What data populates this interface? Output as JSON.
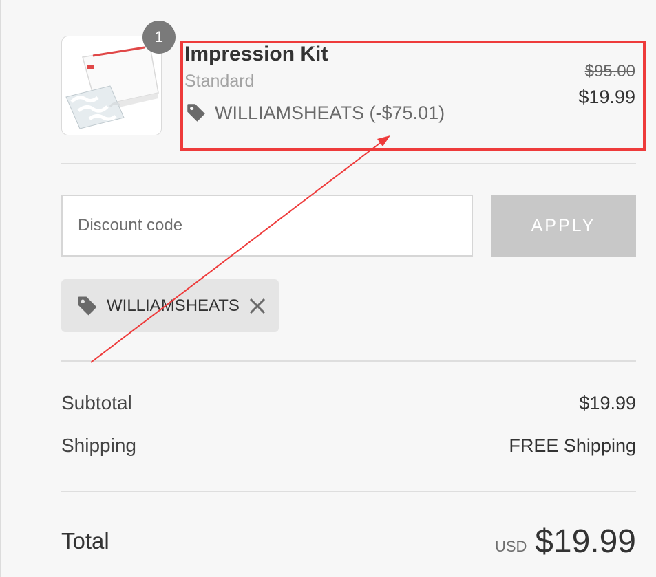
{
  "product": {
    "quantity": "1",
    "title": "Impression Kit",
    "variant": "Standard",
    "discount_text": "WILLIAMSHEATS (-$75.01)",
    "original_price": "$95.00",
    "price": "$19.99",
    "image": "impression-kit-box-with-trays"
  },
  "discount": {
    "placeholder": "Discount code",
    "apply_label": "APPLY",
    "applied_code": "WILLIAMSHEATS"
  },
  "summary": {
    "subtotal_label": "Subtotal",
    "subtotal_value": "$19.99",
    "shipping_label": "Shipping",
    "shipping_value": "FREE Shipping",
    "total_label": "Total",
    "currency": "USD",
    "total_value": "$19.99"
  },
  "annotation_color": "#ee3b3b",
  "icons": {
    "discount_tag": "tag-icon",
    "remove": "close-icon"
  }
}
